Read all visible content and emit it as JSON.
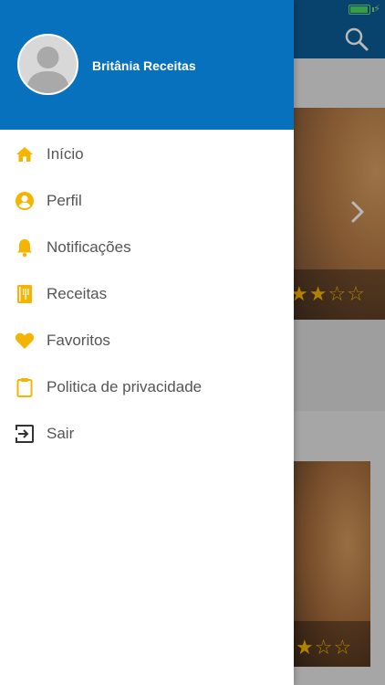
{
  "profile": {
    "name": "Britânia Receitas"
  },
  "menu": [
    {
      "label": "Início",
      "icon": "home-icon"
    },
    {
      "label": "Perfil",
      "icon": "account-circle-icon"
    },
    {
      "label": "Notificações",
      "icon": "bell-icon"
    },
    {
      "label": "Receitas",
      "icon": "recipe-book-icon"
    },
    {
      "label": "Favoritos",
      "icon": "heart-icon"
    },
    {
      "label": "Politica de privacidade",
      "icon": "clipboard-icon"
    },
    {
      "label": "Sair",
      "icon": "exit-icon"
    }
  ],
  "colors": {
    "header_blue": "#0871bd",
    "app_bar_blue": "#0a5e96",
    "icon_accent": "#f5b400",
    "label_text": "#555555"
  },
  "background": {
    "card1_rating": {
      "filled": 2,
      "total": 4
    },
    "card2_rating": {
      "filled": 1,
      "total": 3
    }
  }
}
